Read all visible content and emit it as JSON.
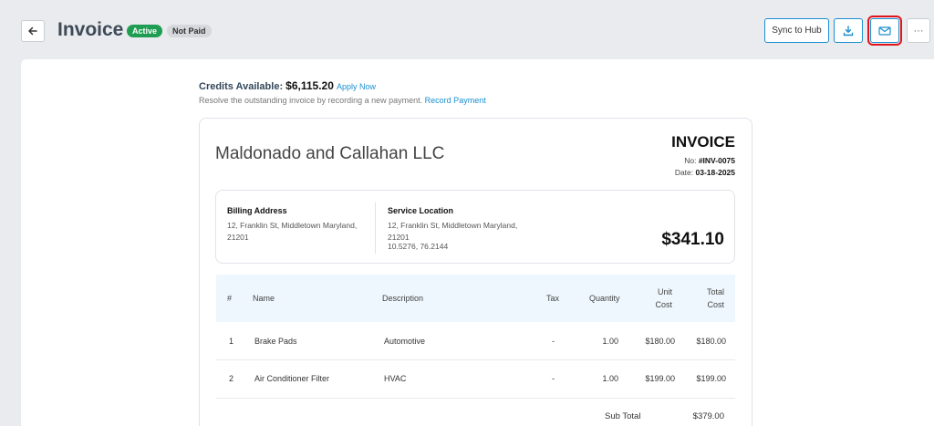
{
  "header": {
    "title": "Invoice",
    "badges": {
      "active": "Active",
      "not_paid": "Not Paid"
    },
    "sync_label": "Sync to Hub",
    "more_label": "···",
    "colors": {
      "accent": "#1a8fd0",
      "active": "#1f9d52",
      "highlight": "#e0151c"
    }
  },
  "credits": {
    "label": "Credits Available:",
    "amount": "$6,115.20",
    "apply_link": "Apply Now",
    "resolve_text": "Resolve the outstanding invoice by recording a new payment.",
    "record_link": "Record Payment"
  },
  "invoice": {
    "company": "Maldonado and Callahan LLC",
    "heading": "INVOICE",
    "no_label": "No:",
    "no_value": "#INV-0075",
    "date_label": "Date:",
    "date_value": "03-18-2025",
    "total": "$341.10",
    "billing": {
      "heading": "Billing Address",
      "line1": "12, Franklin St, Middletown Maryland,",
      "line2": "21201"
    },
    "service": {
      "heading": "Service Location",
      "line1": "12, Franklin St, Middletown Maryland,",
      "line2": "21201",
      "line3": "10.5276, 76.2144"
    }
  },
  "table": {
    "headers": {
      "num": "#",
      "name": "Name",
      "description": "Description",
      "tax": "Tax",
      "quantity": "Quantity",
      "unit_cost_1": "Unit",
      "unit_cost_2": "Cost",
      "total_cost_1": "Total",
      "total_cost_2": "Cost"
    },
    "rows": [
      {
        "num": "1",
        "name": "Brake Pads",
        "description": "Automotive",
        "tax": "-",
        "quantity": "1.00",
        "unit_cost": "$180.00",
        "total_cost": "$180.00"
      },
      {
        "num": "2",
        "name": "Air Conditioner Filter",
        "description": "HVAC",
        "tax": "-",
        "quantity": "1.00",
        "unit_cost": "$199.00",
        "total_cost": "$199.00"
      }
    ],
    "subtotal_label": "Sub Total",
    "subtotal_value": "$379.00"
  },
  "icons": {
    "back": "arrow-left-icon",
    "download": "download-icon",
    "email": "email-send-icon",
    "more": "more-dots-icon"
  }
}
